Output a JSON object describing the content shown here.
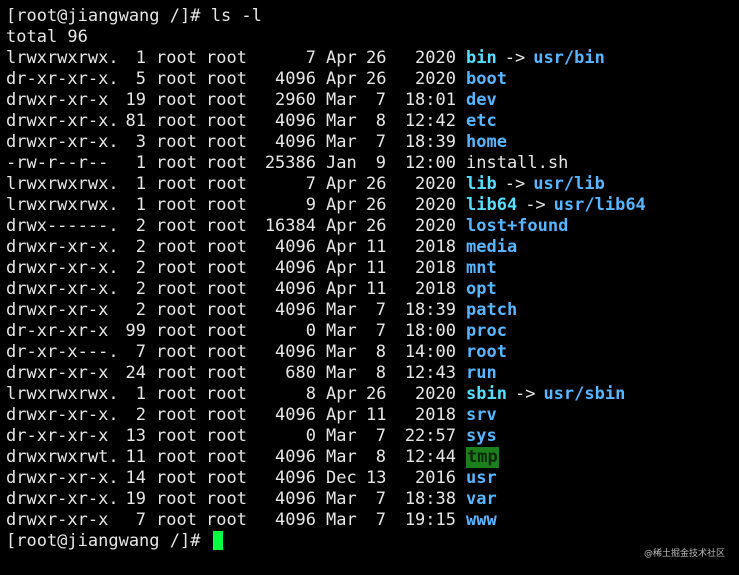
{
  "prompt": "[root@jiangwang /]# ",
  "command": "ls -l",
  "total": "total 96",
  "entries": [
    {
      "mode": "lrwxrwxrwx.",
      "links": "1",
      "owner": "root",
      "group": "root",
      "size": "7",
      "month": "Apr",
      "day": "26",
      "time": "2020",
      "name": "bin",
      "type": "link",
      "target": "usr/bin"
    },
    {
      "mode": "dr-xr-xr-x.",
      "links": "5",
      "owner": "root",
      "group": "root",
      "size": "4096",
      "month": "Apr",
      "day": "26",
      "time": "2020",
      "name": "boot",
      "type": "dir"
    },
    {
      "mode": "drwxr-xr-x",
      "links": "19",
      "owner": "root",
      "group": "root",
      "size": "2960",
      "month": "Mar",
      "day": "7",
      "time": "18:01",
      "name": "dev",
      "type": "dir"
    },
    {
      "mode": "drwxr-xr-x.",
      "links": "81",
      "owner": "root",
      "group": "root",
      "size": "4096",
      "month": "Mar",
      "day": "8",
      "time": "12:42",
      "name": "etc",
      "type": "dir"
    },
    {
      "mode": "drwxr-xr-x.",
      "links": "3",
      "owner": "root",
      "group": "root",
      "size": "4096",
      "month": "Mar",
      "day": "7",
      "time": "18:39",
      "name": "home",
      "type": "dir"
    },
    {
      "mode": "-rw-r--r--",
      "links": "1",
      "owner": "root",
      "group": "root",
      "size": "25386",
      "month": "Jan",
      "day": "9",
      "time": "12:00",
      "name": "install.sh",
      "type": "file"
    },
    {
      "mode": "lrwxrwxrwx.",
      "links": "1",
      "owner": "root",
      "group": "root",
      "size": "7",
      "month": "Apr",
      "day": "26",
      "time": "2020",
      "name": "lib",
      "type": "link",
      "target": "usr/lib"
    },
    {
      "mode": "lrwxrwxrwx.",
      "links": "1",
      "owner": "root",
      "group": "root",
      "size": "9",
      "month": "Apr",
      "day": "26",
      "time": "2020",
      "name": "lib64",
      "type": "link",
      "target": "usr/lib64"
    },
    {
      "mode": "drwx------.",
      "links": "2",
      "owner": "root",
      "group": "root",
      "size": "16384",
      "month": "Apr",
      "day": "26",
      "time": "2020",
      "name": "lost+found",
      "type": "dir"
    },
    {
      "mode": "drwxr-xr-x.",
      "links": "2",
      "owner": "root",
      "group": "root",
      "size": "4096",
      "month": "Apr",
      "day": "11",
      "time": "2018",
      "name": "media",
      "type": "dir"
    },
    {
      "mode": "drwxr-xr-x.",
      "links": "2",
      "owner": "root",
      "group": "root",
      "size": "4096",
      "month": "Apr",
      "day": "11",
      "time": "2018",
      "name": "mnt",
      "type": "dir"
    },
    {
      "mode": "drwxr-xr-x.",
      "links": "2",
      "owner": "root",
      "group": "root",
      "size": "4096",
      "month": "Apr",
      "day": "11",
      "time": "2018",
      "name": "opt",
      "type": "dir"
    },
    {
      "mode": "drwxr-xr-x",
      "links": "2",
      "owner": "root",
      "group": "root",
      "size": "4096",
      "month": "Mar",
      "day": "7",
      "time": "18:39",
      "name": "patch",
      "type": "dir"
    },
    {
      "mode": "dr-xr-xr-x",
      "links": "99",
      "owner": "root",
      "group": "root",
      "size": "0",
      "month": "Mar",
      "day": "7",
      "time": "18:00",
      "name": "proc",
      "type": "dir"
    },
    {
      "mode": "dr-xr-x---.",
      "links": "7",
      "owner": "root",
      "group": "root",
      "size": "4096",
      "month": "Mar",
      "day": "8",
      "time": "14:00",
      "name": "root",
      "type": "dir"
    },
    {
      "mode": "drwxr-xr-x",
      "links": "24",
      "owner": "root",
      "group": "root",
      "size": "680",
      "month": "Mar",
      "day": "8",
      "time": "12:43",
      "name": "run",
      "type": "dir"
    },
    {
      "mode": "lrwxrwxrwx.",
      "links": "1",
      "owner": "root",
      "group": "root",
      "size": "8",
      "month": "Apr",
      "day": "26",
      "time": "2020",
      "name": "sbin",
      "type": "link",
      "target": "usr/sbin"
    },
    {
      "mode": "drwxr-xr-x.",
      "links": "2",
      "owner": "root",
      "group": "root",
      "size": "4096",
      "month": "Apr",
      "day": "11",
      "time": "2018",
      "name": "srv",
      "type": "dir"
    },
    {
      "mode": "dr-xr-xr-x",
      "links": "13",
      "owner": "root",
      "group": "root",
      "size": "0",
      "month": "Mar",
      "day": "7",
      "time": "22:57",
      "name": "sys",
      "type": "dir"
    },
    {
      "mode": "drwxrwxrwt.",
      "links": "11",
      "owner": "root",
      "group": "root",
      "size": "4096",
      "month": "Mar",
      "day": "8",
      "time": "12:44",
      "name": "tmp",
      "type": "sticky"
    },
    {
      "mode": "drwxr-xr-x.",
      "links": "14",
      "owner": "root",
      "group": "root",
      "size": "4096",
      "month": "Dec",
      "day": "13",
      "time": "2016",
      "name": "usr",
      "type": "dir"
    },
    {
      "mode": "drwxr-xr-x.",
      "links": "19",
      "owner": "root",
      "group": "root",
      "size": "4096",
      "month": "Mar",
      "day": "7",
      "time": "18:38",
      "name": "var",
      "type": "dir"
    },
    {
      "mode": "drwxr-xr-x",
      "links": "7",
      "owner": "root",
      "group": "root",
      "size": "4096",
      "month": "Mar",
      "day": "7",
      "time": "19:15",
      "name": "www",
      "type": "dir"
    }
  ],
  "arrow": "->",
  "watermark": "@稀土掘金技术社区",
  "colors": {
    "background": "#000000",
    "text": "#e6e6e6",
    "dir": "#56b6ff",
    "link": "#56e0ff",
    "sticky_bg": "#1b7f1b",
    "cursor": "#00ff41"
  }
}
